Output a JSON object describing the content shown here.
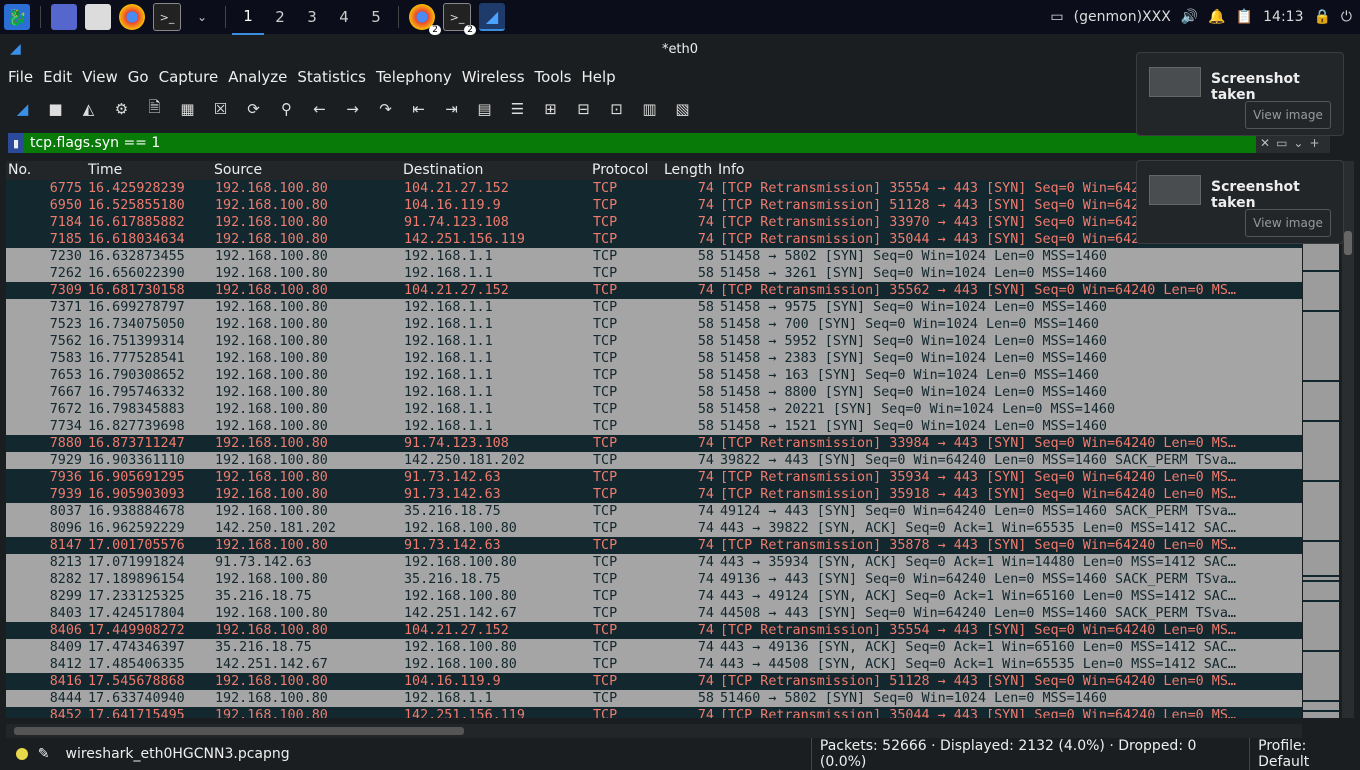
{
  "taskbar": {
    "workspaces": [
      "1",
      "2",
      "3",
      "4",
      "5"
    ],
    "chrome_badge": "2",
    "terminal_badge": "2",
    "genmon": "(genmon)XXX",
    "clock": "14:13"
  },
  "window": {
    "title": "*eth0"
  },
  "menu": [
    "File",
    "Edit",
    "View",
    "Go",
    "Capture",
    "Analyze",
    "Statistics",
    "Telephony",
    "Wireless",
    "Tools",
    "Help"
  ],
  "filter": {
    "value": "tcp.flags.syn == 1"
  },
  "columns": {
    "no": "No.",
    "time": "Time",
    "source": "Source",
    "destination": "Destination",
    "protocol": "Protocol",
    "length": "Length",
    "info": "Info"
  },
  "packets": [
    {
      "no": "6775",
      "time": "16.425928239",
      "src": "192.168.100.80",
      "dst": "104.21.27.152",
      "proto": "TCP",
      "len": "74",
      "info": "[TCP Retransmission] 35554 → 443 [SYN] Seq=0 Win=64240 Len=0 MS…",
      "type": "ret"
    },
    {
      "no": "6950",
      "time": "16.525855180",
      "src": "192.168.100.80",
      "dst": "104.16.119.9",
      "proto": "TCP",
      "len": "74",
      "info": "[TCP Retransmission] 51128 → 443 [SYN] Seq=0 Win=64240 Len=0 MS…",
      "type": "ret"
    },
    {
      "no": "7184",
      "time": "16.617885882",
      "src": "192.168.100.80",
      "dst": "91.74.123.108",
      "proto": "TCP",
      "len": "74",
      "info": "[TCP Retransmission] 33970 → 443 [SYN] Seq=0 Win=64240 Len=0 MS…",
      "type": "ret"
    },
    {
      "no": "7185",
      "time": "16.618034634",
      "src": "192.168.100.80",
      "dst": "142.251.156.119",
      "proto": "TCP",
      "len": "74",
      "info": "[TCP Retransmission] 35044 → 443 [SYN] Seq=0 Win=64240 Len=0 MS…",
      "type": "ret"
    },
    {
      "no": "7230",
      "time": "16.632873455",
      "src": "192.168.100.80",
      "dst": "192.168.1.1",
      "proto": "TCP",
      "len": "58",
      "info": "51458 → 5802 [SYN] Seq=0 Win=1024 Len=0 MSS=1460",
      "type": "ok"
    },
    {
      "no": "7262",
      "time": "16.656022390",
      "src": "192.168.100.80",
      "dst": "192.168.1.1",
      "proto": "TCP",
      "len": "58",
      "info": "51458 → 3261 [SYN] Seq=0 Win=1024 Len=0 MSS=1460",
      "type": "ok"
    },
    {
      "no": "7309",
      "time": "16.681730158",
      "src": "192.168.100.80",
      "dst": "104.21.27.152",
      "proto": "TCP",
      "len": "74",
      "info": "[TCP Retransmission] 35562 → 443 [SYN] Seq=0 Win=64240 Len=0 MS…",
      "type": "ret"
    },
    {
      "no": "7371",
      "time": "16.699278797",
      "src": "192.168.100.80",
      "dst": "192.168.1.1",
      "proto": "TCP",
      "len": "58",
      "info": "51458 → 9575 [SYN] Seq=0 Win=1024 Len=0 MSS=1460",
      "type": "ok"
    },
    {
      "no": "7523",
      "time": "16.734075050",
      "src": "192.168.100.80",
      "dst": "192.168.1.1",
      "proto": "TCP",
      "len": "58",
      "info": "51458 → 700 [SYN] Seq=0 Win=1024 Len=0 MSS=1460",
      "type": "ok"
    },
    {
      "no": "7562",
      "time": "16.751399314",
      "src": "192.168.100.80",
      "dst": "192.168.1.1",
      "proto": "TCP",
      "len": "58",
      "info": "51458 → 5952 [SYN] Seq=0 Win=1024 Len=0 MSS=1460",
      "type": "ok"
    },
    {
      "no": "7583",
      "time": "16.777528541",
      "src": "192.168.100.80",
      "dst": "192.168.1.1",
      "proto": "TCP",
      "len": "58",
      "info": "51458 → 2383 [SYN] Seq=0 Win=1024 Len=0 MSS=1460",
      "type": "ok"
    },
    {
      "no": "7653",
      "time": "16.790308652",
      "src": "192.168.100.80",
      "dst": "192.168.1.1",
      "proto": "TCP",
      "len": "58",
      "info": "51458 → 163 [SYN] Seq=0 Win=1024 Len=0 MSS=1460",
      "type": "ok"
    },
    {
      "no": "7667",
      "time": "16.795746332",
      "src": "192.168.100.80",
      "dst": "192.168.1.1",
      "proto": "TCP",
      "len": "58",
      "info": "51458 → 8800 [SYN] Seq=0 Win=1024 Len=0 MSS=1460",
      "type": "ok"
    },
    {
      "no": "7672",
      "time": "16.798345883",
      "src": "192.168.100.80",
      "dst": "192.168.1.1",
      "proto": "TCP",
      "len": "58",
      "info": "51458 → 20221 [SYN] Seq=0 Win=1024 Len=0 MSS=1460",
      "type": "ok"
    },
    {
      "no": "7734",
      "time": "16.827739698",
      "src": "192.168.100.80",
      "dst": "192.168.1.1",
      "proto": "TCP",
      "len": "58",
      "info": "51458 → 1521 [SYN] Seq=0 Win=1024 Len=0 MSS=1460",
      "type": "ok"
    },
    {
      "no": "7880",
      "time": "16.873711247",
      "src": "192.168.100.80",
      "dst": "91.74.123.108",
      "proto": "TCP",
      "len": "74",
      "info": "[TCP Retransmission] 33984 → 443 [SYN] Seq=0 Win=64240 Len=0 MS…",
      "type": "ret"
    },
    {
      "no": "7929",
      "time": "16.903361110",
      "src": "192.168.100.80",
      "dst": "142.250.181.202",
      "proto": "TCP",
      "len": "74",
      "info": "39822 → 443 [SYN] Seq=0 Win=64240 Len=0 MSS=1460 SACK_PERM TSva…",
      "type": "ok"
    },
    {
      "no": "7936",
      "time": "16.905691295",
      "src": "192.168.100.80",
      "dst": "91.73.142.63",
      "proto": "TCP",
      "len": "74",
      "info": "[TCP Retransmission] 35934 → 443 [SYN] Seq=0 Win=64240 Len=0 MS…",
      "type": "ret"
    },
    {
      "no": "7939",
      "time": "16.905903093",
      "src": "192.168.100.80",
      "dst": "91.73.142.63",
      "proto": "TCP",
      "len": "74",
      "info": "[TCP Retransmission] 35918 → 443 [SYN] Seq=0 Win=64240 Len=0 MS…",
      "type": "ret"
    },
    {
      "no": "8037",
      "time": "16.938884678",
      "src": "192.168.100.80",
      "dst": "35.216.18.75",
      "proto": "TCP",
      "len": "74",
      "info": "49124 → 443 [SYN] Seq=0 Win=64240 Len=0 MSS=1460 SACK_PERM TSva…",
      "type": "ok"
    },
    {
      "no": "8096",
      "time": "16.962592229",
      "src": "142.250.181.202",
      "dst": "192.168.100.80",
      "proto": "TCP",
      "len": "74",
      "info": "443 → 39822 [SYN, ACK] Seq=0 Ack=1 Win=65535 Len=0 MSS=1412 SAC…",
      "type": "ok"
    },
    {
      "no": "8147",
      "time": "17.001705576",
      "src": "192.168.100.80",
      "dst": "91.73.142.63",
      "proto": "TCP",
      "len": "74",
      "info": "[TCP Retransmission] 35878 → 443 [SYN] Seq=0 Win=64240 Len=0 MS…",
      "type": "ret"
    },
    {
      "no": "8213",
      "time": "17.071991824",
      "src": "91.73.142.63",
      "dst": "192.168.100.80",
      "proto": "TCP",
      "len": "74",
      "info": "443 → 35934 [SYN, ACK] Seq=0 Ack=1 Win=14480 Len=0 MSS=1412 SAC…",
      "type": "ok"
    },
    {
      "no": "8282",
      "time": "17.189896154",
      "src": "192.168.100.80",
      "dst": "35.216.18.75",
      "proto": "TCP",
      "len": "74",
      "info": "49136 → 443 [SYN] Seq=0 Win=64240 Len=0 MSS=1460 SACK_PERM TSva…",
      "type": "ok"
    },
    {
      "no": "8299",
      "time": "17.233125325",
      "src": "35.216.18.75",
      "dst": "192.168.100.80",
      "proto": "TCP",
      "len": "74",
      "info": "443 → 49124 [SYN, ACK] Seq=0 Ack=1 Win=65160 Len=0 MSS=1412 SAC…",
      "type": "ok"
    },
    {
      "no": "8403",
      "time": "17.424517804",
      "src": "192.168.100.80",
      "dst": "142.251.142.67",
      "proto": "TCP",
      "len": "74",
      "info": "44508 → 443 [SYN] Seq=0 Win=64240 Len=0 MSS=1460 SACK_PERM TSva…",
      "type": "ok"
    },
    {
      "no": "8406",
      "time": "17.449908272",
      "src": "192.168.100.80",
      "dst": "104.21.27.152",
      "proto": "TCP",
      "len": "74",
      "info": "[TCP Retransmission] 35554 → 443 [SYN] Seq=0 Win=64240 Len=0 MS…",
      "type": "ret"
    },
    {
      "no": "8409",
      "time": "17.474346397",
      "src": "35.216.18.75",
      "dst": "192.168.100.80",
      "proto": "TCP",
      "len": "74",
      "info": "443 → 49136 [SYN, ACK] Seq=0 Ack=1 Win=65160 Len=0 MSS=1412 SAC…",
      "type": "ok"
    },
    {
      "no": "8412",
      "time": "17.485406335",
      "src": "142.251.142.67",
      "dst": "192.168.100.80",
      "proto": "TCP",
      "len": "74",
      "info": "443 → 44508 [SYN, ACK] Seq=0 Ack=1 Win=65535 Len=0 MSS=1412 SAC…",
      "type": "ok"
    },
    {
      "no": "8416",
      "time": "17.545678868",
      "src": "192.168.100.80",
      "dst": "104.16.119.9",
      "proto": "TCP",
      "len": "74",
      "info": "[TCP Retransmission] 51128 → 443 [SYN] Seq=0 Win=64240 Len=0 MS…",
      "type": "ret"
    },
    {
      "no": "8444",
      "time": "17.633740940",
      "src": "192.168.100.80",
      "dst": "192.168.1.1",
      "proto": "TCP",
      "len": "58",
      "info": "51460 → 5802 [SYN] Seq=0 Win=1024 Len=0 MSS=1460",
      "type": "ok"
    },
    {
      "no": "8452",
      "time": "17.641715495",
      "src": "192.168.100.80",
      "dst": "142.251.156.119",
      "proto": "TCP",
      "len": "74",
      "info": "[TCP Retransmission] 35044 → 443 [SYN] Seq=0 Win=64240 Len=0 MS…",
      "type": "ret"
    }
  ],
  "status": {
    "file": "wireshark_eth0HGCNN3.pcapng",
    "stats": "Packets: 52666 · Displayed: 2132 (4.0%) · Dropped: 0 (0.0%)",
    "profile": "Profile: Default"
  },
  "notifications": [
    {
      "title": "Screenshot taken",
      "button": "View image"
    },
    {
      "title": "Screenshot taken",
      "button": "View image"
    }
  ],
  "colors": {
    "retransmission_bg": "#12272e",
    "retransmission_fg": "#f07b6e",
    "normal_bg": "#a5a5a5",
    "filter_bg": "#087a08"
  }
}
